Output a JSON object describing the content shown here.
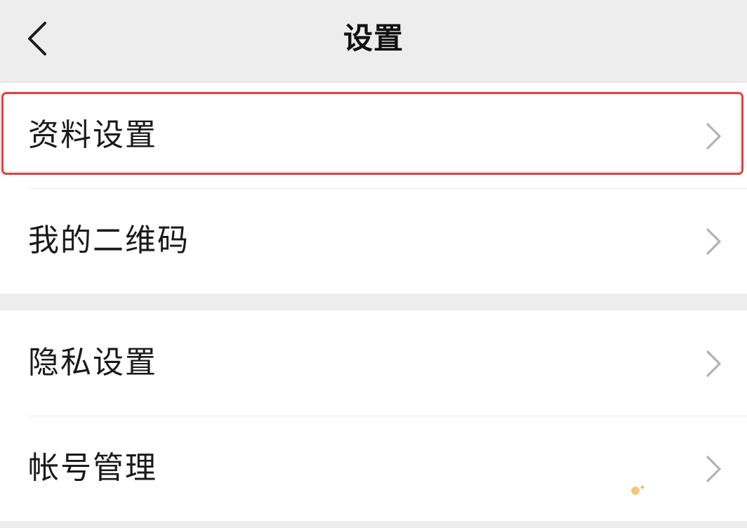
{
  "header": {
    "title": "设置",
    "back_icon": "chevron-left-icon"
  },
  "groups": [
    {
      "items": [
        {
          "label": "资料设置",
          "icon": "chevron-right-icon",
          "highlighted": true
        },
        {
          "label": "我的二维码",
          "icon": "chevron-right-icon",
          "highlighted": false
        }
      ]
    },
    {
      "items": [
        {
          "label": "隐私设置",
          "icon": "chevron-right-icon",
          "highlighted": false
        },
        {
          "label": "帐号管理",
          "icon": "chevron-right-icon",
          "highlighted": false
        }
      ]
    }
  ],
  "colors": {
    "background": "#ededed",
    "card": "#ffffff",
    "highlight": "#f23a3a",
    "chevron": "#b2b2b2"
  }
}
